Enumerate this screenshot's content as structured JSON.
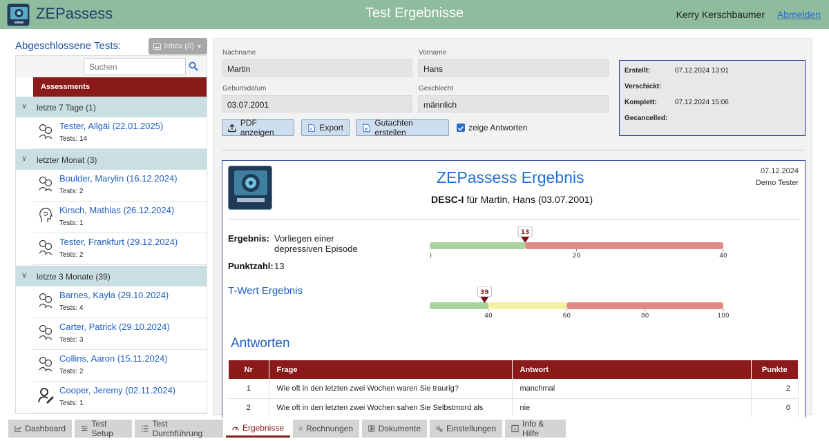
{
  "header": {
    "app_name": "ZEPassess",
    "page_title": "Test Ergebnisse",
    "user_name": "Kerry Kerschbaumer",
    "logout_label": "Abmelden"
  },
  "sidebar": {
    "title": "Abgeschlossene Tests:",
    "inbox_label": "Inbox (0)",
    "search_placeholder": "Suchen",
    "assessments_header": "Assessments",
    "groups": [
      {
        "label": "letzte 7 Tage (1)"
      },
      {
        "label": "letzter Monat (3)"
      },
      {
        "label": "letzte 3 Monate (39)"
      }
    ],
    "items": [
      {
        "name": "Tester, Allgäi (22.01.2025)",
        "tests": "Tests: 14",
        "icon": "multi-person-icon"
      },
      {
        "name": "Boulder, Marylin (16.12.2024)",
        "tests": "Tests: 2",
        "icon": "multi-person-icon"
      },
      {
        "name": "Kirsch, Mathias (26.12.2024)",
        "tests": "Tests: 1",
        "icon": "brain-head-icon"
      },
      {
        "name": "Tester, Frankfurt (29.12.2024)",
        "tests": "Tests: 2",
        "icon": "multi-person-icon"
      },
      {
        "name": "Barnes, Kayla (29.10.2024)",
        "tests": "Tests: 4",
        "icon": "multi-person-icon"
      },
      {
        "name": "Carter, Patrick (29.10.2024)",
        "tests": "Tests: 3",
        "icon": "multi-person-icon"
      },
      {
        "name": "Collins, Aaron (15.11.2024)",
        "tests": "Tests: 2",
        "icon": "multi-person-icon"
      },
      {
        "name": "Cooper, Jeremy (02.11.2024)",
        "tests": "Tests: 1",
        "icon": "person-edit-icon"
      }
    ]
  },
  "patient": {
    "nachname_label": "Nachname",
    "nachname": "Martin",
    "vorname_label": "Vorname",
    "vorname": "Hans",
    "geburtsdatum_label": "Geburtsdatum",
    "geburtsdatum": "03.07.2001",
    "geschlecht_label": "Geschlecht",
    "geschlecht": "männlich"
  },
  "actions": {
    "pdf_label": "PDF anzeigen",
    "export_label": "Export",
    "gutachten_label": "Gutachten erstellen",
    "show_answers_label": "zeige Antworten",
    "show_answers_checked": true
  },
  "status": {
    "erstellt_label": "Erstellt:",
    "erstellt": "07.12.2024 13:01",
    "verschickt_label": "Verschickt:",
    "verschickt": "",
    "komplett_label": "Komplett:",
    "komplett": "07.12.2024 15:06",
    "gecancelled_label": "Gecancelled:",
    "gecancelled": ""
  },
  "report": {
    "title": "ZEPassess Ergebnis",
    "test_name": "DESC-I",
    "subtitle_rest": " für Martin, Hans (03.07.2001)",
    "date": "07.12.2024",
    "tester": "Demo Tester",
    "ergebnis_label": "Ergebnis:",
    "ergebnis_value": "Vorliegen einer depressiven Episode",
    "punktzahl_label": "Punktzahl:",
    "punktzahl_value": "13",
    "twert_title": "T-Wert Ergebnis",
    "antworten_title": "Antworten",
    "score_gauge": {
      "min": 0,
      "max": 40,
      "value": 13,
      "value_label": "13",
      "ticks": [
        0,
        20,
        40
      ],
      "tick_labels": [
        "0",
        "20",
        "40"
      ],
      "segments": [
        {
          "from": 0,
          "to": 13,
          "color": "#a9d4a0"
        },
        {
          "from": 13,
          "to": 40,
          "color": "#e08a85"
        }
      ]
    },
    "t_gauge": {
      "min": 25,
      "max": 100,
      "value": 39,
      "value_label": "39",
      "ticks": [
        40,
        60,
        80,
        100
      ],
      "tick_labels": [
        "40",
        "60",
        "80",
        "100"
      ],
      "segments": [
        {
          "from": 25,
          "to": 40,
          "color": "#a9d4a0"
        },
        {
          "from": 40,
          "to": 60,
          "color": "#f4f2a0"
        },
        {
          "from": 60,
          "to": 100,
          "color": "#e08a85"
        }
      ]
    },
    "table": {
      "headers": [
        "Nr",
        "Frage",
        "Antwort",
        "Punkte"
      ],
      "rows": [
        {
          "nr": "1",
          "frage": "Wie oft in den letzten zwei Wochen waren Sie traurig?",
          "antwort": "manchmal",
          "punkte": "2"
        },
        {
          "nr": "2",
          "frage": "Wie oft in den letzten zwei Wochen sahen Sie Selbstmord als",
          "antwort": "nie",
          "punkte": "0"
        }
      ]
    }
  },
  "tabs": [
    {
      "label": "Dashboard",
      "icon": "chart-icon",
      "active": false
    },
    {
      "label": "Test Setup",
      "icon": "sliders-icon",
      "active": false
    },
    {
      "label": "Test Durchführung",
      "icon": "list-icon",
      "active": false
    },
    {
      "label": "Ergebnisse",
      "icon": "gauge-icon",
      "active": true
    },
    {
      "label": "Rechnungen",
      "icon": "document-icon",
      "active": false
    },
    {
      "label": "Dokumente",
      "icon": "folder-icon",
      "active": false
    },
    {
      "label": "Einstellungen",
      "icon": "gears-icon",
      "active": false
    },
    {
      "label": "Info & Hilfe",
      "icon": "info-icon",
      "active": false
    }
  ],
  "colors": {
    "header_bg": "#8fbc9c",
    "accent_red": "#8b1a1a",
    "link_blue": "#1f5fc0",
    "group_bg": "#c9dfe1"
  }
}
